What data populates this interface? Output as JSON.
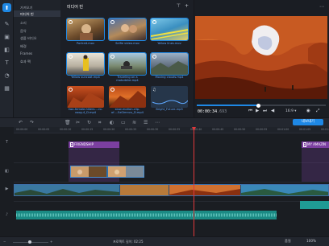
{
  "sidebar": {
    "categories": [
      {
        "label": "가져오기"
      },
      {
        "label": "미디어 빈"
      },
      {
        "label": "소리"
      },
      {
        "label": "음악"
      },
      {
        "label": "샘플 비디오"
      },
      {
        "label": "배경"
      },
      {
        "label": "Frames"
      },
      {
        "label": "효과 팩"
      }
    ]
  },
  "media_bin": {
    "title": "미디어 빈",
    "items": [
      {
        "label": "Portrait.mov"
      },
      {
        "label": "Selfie video.mov"
      },
      {
        "label": "Yellow lines.mov"
      },
      {
        "label": "Yellow suncoat.mp4"
      },
      {
        "label": "Traveling on a motorbike.mp4"
      },
      {
        "label": "Moving clouds.mp4"
      },
      {
        "label": "two-female-hikers-...ro-voog-4_D.mp4"
      },
      {
        "label": "slow-motion-clip-of-...5zGimnvu_D.mp4"
      },
      {
        "label": "Bright_Future.mp3"
      }
    ]
  },
  "preview": {
    "time_main": "00:00:34",
    "time_frac": ".693",
    "aspect": "16:9",
    "progress": 0.48
  },
  "toolbar": {
    "export_label": "내보내기"
  },
  "ruler": {
    "ticks": [
      "00:00:00",
      "00:00:05",
      "00:00:10",
      "00:00:15",
      "00:00:20",
      "00:00:25",
      "00:00:30",
      "00:00:35",
      "00:00:40",
      "00:00:45",
      "00:00:50",
      "00:00:55",
      "00:01:00",
      "00:01:05",
      "00:01:10"
    ]
  },
  "timeline": {
    "title_clip_1": "FRIENDSHIP",
    "title_clip_2": "MY AMAZIN"
  },
  "status": {
    "duration": "프로젝트 길이: 02:25",
    "right_1": "품질",
    "right_2": "100%"
  }
}
